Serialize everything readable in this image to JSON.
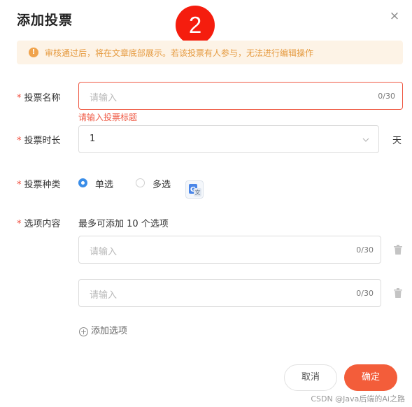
{
  "dialog": {
    "title": "添加投票",
    "close_label": "×",
    "step_badge": "2"
  },
  "notice": {
    "icon": "warning-icon",
    "icon_glyph": "!",
    "text": "审核通过后，将在文章底部展示。若该投票有人参与，无法进行编辑操作"
  },
  "form": {
    "required_mark": "*",
    "name": {
      "label": "投票名称",
      "placeholder": "请输入",
      "counter": "0/30",
      "error": "请输入投票标题"
    },
    "duration": {
      "label": "投票时长",
      "value": "1",
      "unit": "天"
    },
    "type": {
      "label": "投票种类",
      "options": [
        "单选",
        "多选"
      ],
      "selected": "单选"
    },
    "options": {
      "label": "选项内容",
      "hint": "最多可添加 10 个选项",
      "items": [
        {
          "placeholder": "请输入",
          "counter": "0/30"
        },
        {
          "placeholder": "请输入",
          "counter": "0/30"
        }
      ],
      "add_label": "添加选项"
    }
  },
  "footer": {
    "cancel_label": "取消",
    "confirm_label": "确定"
  },
  "watermark": "CSDN @Java后端的Ai之路",
  "colors": {
    "accent": "#f35d3a",
    "error": "#ef5a45",
    "radio_checked": "#3a8de8",
    "notice_bg": "#fdf3e6",
    "notice_text": "#e59a3f",
    "badge": "#f51d0e"
  }
}
